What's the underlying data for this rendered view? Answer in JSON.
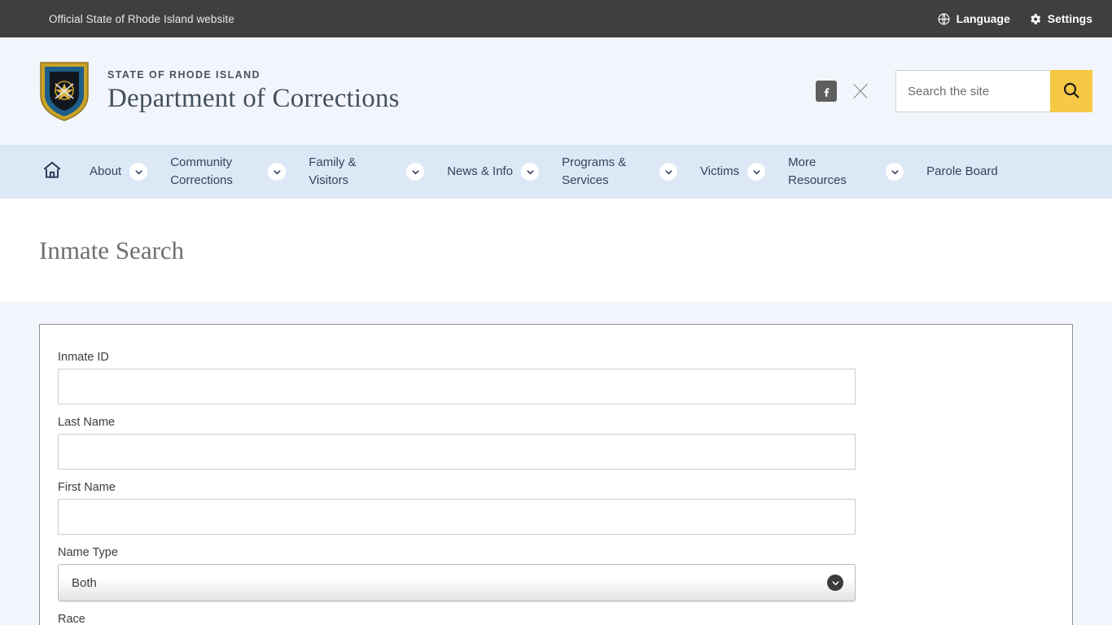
{
  "topbar": {
    "official_text": "Official State of Rhode Island website",
    "language_label": "Language",
    "settings_label": "Settings"
  },
  "header": {
    "eyebrow": "STATE OF RHODE ISLAND",
    "title": "Department of Corrections",
    "logo_alt": "Rhode Island Department of Corrections shield",
    "social": [
      {
        "name": "facebook",
        "label": "f"
      },
      {
        "name": "x-twitter",
        "label": "X"
      }
    ],
    "search": {
      "placeholder": "Search the site",
      "value": "",
      "button_icon": "search-icon"
    },
    "accent_color": "#f6c945",
    "background_color": "#f2f6fc"
  },
  "nav": {
    "background_color": "#dce8f6",
    "home_icon": "home-icon",
    "items": [
      {
        "label": "About",
        "has_dropdown": true
      },
      {
        "label": "Community Corrections",
        "has_dropdown": true
      },
      {
        "label": "Family & Visitors",
        "has_dropdown": true
      },
      {
        "label": "News & Info",
        "has_dropdown": true
      },
      {
        "label": "Programs & Services",
        "has_dropdown": true
      },
      {
        "label": "Victims",
        "has_dropdown": true
      },
      {
        "label": "More Resources",
        "has_dropdown": true
      },
      {
        "label": "Parole Board",
        "has_dropdown": false
      }
    ]
  },
  "page": {
    "title": "Inmate Search"
  },
  "form": {
    "fields": [
      {
        "label": "Inmate ID",
        "type": "text",
        "value": ""
      },
      {
        "label": "Last Name",
        "type": "text",
        "value": ""
      },
      {
        "label": "First Name",
        "type": "text",
        "value": ""
      },
      {
        "label": "Name Type",
        "type": "select",
        "value": "Both"
      },
      {
        "label": "Race",
        "type": "select",
        "value": ""
      }
    ]
  }
}
